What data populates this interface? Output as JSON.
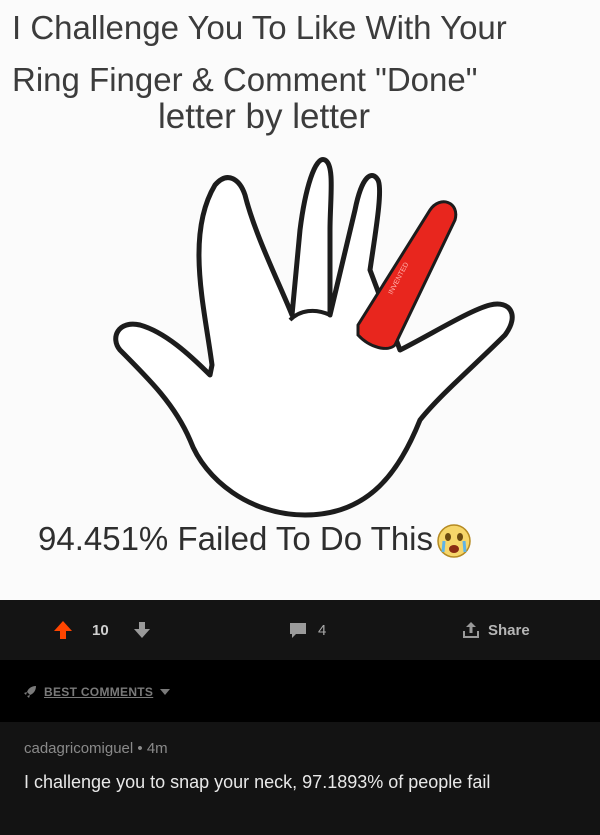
{
  "post": {
    "headline_line1": "I Challenge You To Like With Your",
    "headline_line2": "Ring Finger & Comment \"Done\"",
    "subline": "letter by letter",
    "footer": "94.451% Failed To Do This",
    "watermark": "INVENTED"
  },
  "actions": {
    "upvote_icon": "arrow-up-icon",
    "vote_count": "10",
    "downvote_icon": "arrow-down-icon",
    "comment_icon": "comment-icon",
    "comment_count": "4",
    "share_icon": "share-icon",
    "share_label": "Share",
    "accent_color": "#ff4500"
  },
  "sort": {
    "icon": "rocket-icon",
    "label": "BEST COMMENTS"
  },
  "comment": {
    "author": "cadagricomiguel",
    "separator": "•",
    "age": "4m",
    "text": "I challenge you to snap your neck, 97.1893% of people fail"
  }
}
